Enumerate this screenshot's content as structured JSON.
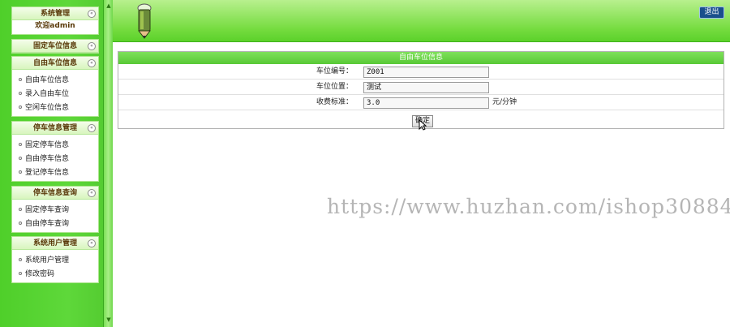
{
  "sidebar": {
    "panels": [
      {
        "title": "系统管理",
        "welcome": "欢迎admin",
        "items": []
      },
      {
        "title": "固定车位信息",
        "items": []
      },
      {
        "title": "自由车位信息",
        "items": [
          "自由车位信息",
          "录入自由车位",
          "空闲车位信息"
        ]
      },
      {
        "title": "停车信息管理",
        "items": [
          "固定停车信息",
          "自由停车信息",
          "登记停车信息"
        ]
      },
      {
        "title": "停车信息查询",
        "items": [
          "固定停车查询",
          "自由停车查询"
        ]
      },
      {
        "title": "系统用户管理",
        "items": [
          "系统用户管理",
          "修改密码"
        ]
      }
    ]
  },
  "header": {
    "logout_label": "退出"
  },
  "form": {
    "title": "自由车位信息",
    "fields": [
      {
        "label": "车位编号：",
        "value": "Z001",
        "unit": ""
      },
      {
        "label": "车位位置：",
        "value": "测试",
        "unit": ""
      },
      {
        "label": "收费标准：",
        "value": "3.0",
        "unit": "元/分钟"
      }
    ],
    "submit_label": "确定"
  },
  "watermark": "https://www.huzhan.com/ishop30884",
  "colors": {
    "accent": "#5ed83a",
    "header_green": "#76dc40",
    "logout_bg": "#1a4f8c"
  }
}
